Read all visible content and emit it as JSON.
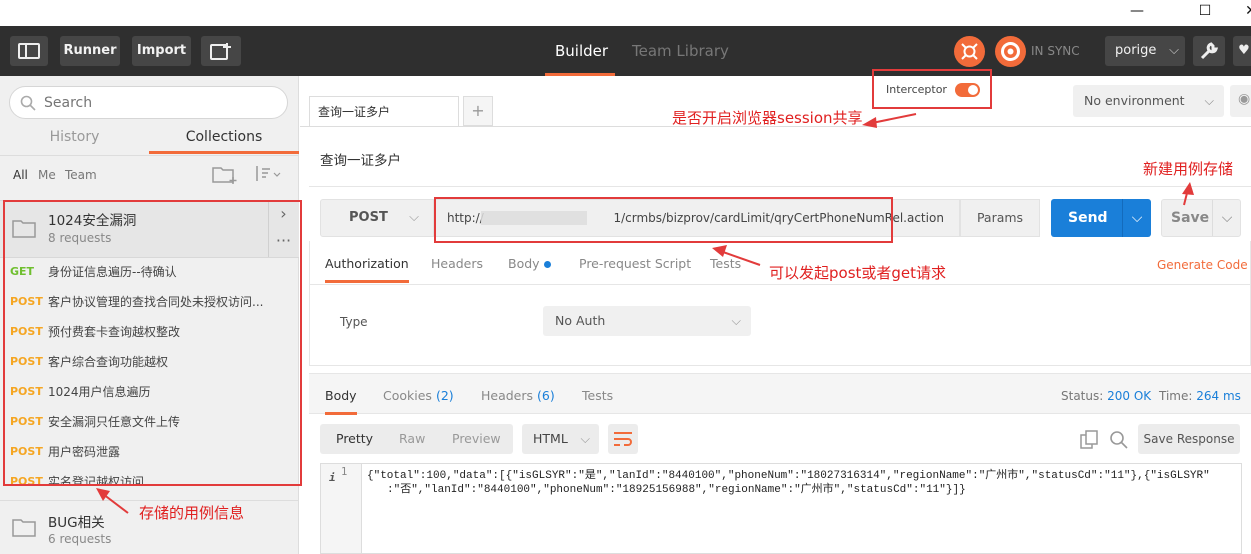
{
  "window": {
    "minimize": "—",
    "maximize": "☐",
    "close": "✕"
  },
  "toolbar": {
    "runner": "Runner",
    "import": "Import",
    "builder": "Builder",
    "team_library": "Team Library",
    "sync": "IN SYNC",
    "user": "porige"
  },
  "sidebar": {
    "search_placeholder": "Search",
    "tabs": {
      "history": "History",
      "collections": "Collections"
    },
    "filters": {
      "all": "All",
      "me": "Me",
      "team": "Team"
    },
    "collection": {
      "name": "1024安全漏洞",
      "count": "8 requests"
    },
    "requests": [
      {
        "method": "GET",
        "title": "身份证信息遍历--待确认"
      },
      {
        "method": "POST",
        "title": "客户协议管理的查找合同处未授权访问..."
      },
      {
        "method": "POST",
        "title": "预付费套卡查询越权整改"
      },
      {
        "method": "POST",
        "title": "客户综合查询功能越权"
      },
      {
        "method": "POST",
        "title": "1024用户信息遍历"
      },
      {
        "method": "POST",
        "title": "安全漏洞只任意文件上传"
      },
      {
        "method": "POST",
        "title": "用户密码泄露"
      },
      {
        "method": "POST",
        "title": "实名登记越权访问"
      }
    ],
    "collection2": {
      "name": "BUG相关",
      "count": "6 requests"
    }
  },
  "interceptor": {
    "label": "Interceptor"
  },
  "environment": {
    "selected": "No environment"
  },
  "request": {
    "tab_name": "查询一证多户",
    "add_tab": "+",
    "name": "查询一证多户",
    "method": "POST",
    "url": "http://                                  1/crmbs/bizprov/cardLimit/qryCertPhoneNumRel.action",
    "params": "Params",
    "send": "Send",
    "save": "Save",
    "tabs": [
      "Authorization",
      "Headers",
      "Body",
      "Pre-request Script",
      "Tests"
    ],
    "generate_code": "Generate Code",
    "auth_type_label": "Type",
    "auth_type": "No Auth"
  },
  "response": {
    "tabs": {
      "body": "Body",
      "cookies": "Cookies",
      "cookies_count": "(2)",
      "headers": "Headers",
      "headers_count": "(6)",
      "tests": "Tests"
    },
    "status_label": "Status:",
    "status": "200 OK",
    "time_label": "Time:",
    "time": "264 ms",
    "views": {
      "pretty": "Pretty",
      "raw": "Raw",
      "preview": "Preview"
    },
    "format": "HTML",
    "save_response": "Save Response",
    "line_number": "1",
    "line1": "{\"total\":100,\"data\":[{\"isGLSYR\":\"是\",\"lanId\":\"8440100\",\"phoneNum\":\"18027316314\",\"regionName\":\"广州市\",\"statusCd\":\"11\"},{\"isGLSYR\"",
    "line2": ":\"否\",\"lanId\":\"8440100\",\"phoneNum\":\"18925156988\",\"regionName\":\"广州市\",\"statusCd\":\"11\"}]}"
  },
  "annotations": {
    "session": "是否开启浏览器session共享",
    "save_case": "新建用例存储",
    "post_get": "可以发起post或者get请求",
    "stored": "存储的用例信息"
  },
  "colors": {
    "accent": "#f26b3a",
    "send": "#1a7fd9",
    "post": "#f5a623",
    "get": "#6fbf2f",
    "annotation": "#e02020"
  }
}
